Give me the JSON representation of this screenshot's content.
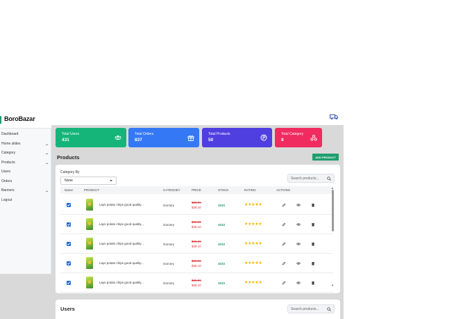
{
  "brand": {
    "name": "BoroBazar"
  },
  "sidebar": {
    "items": [
      {
        "label": "Dashboard",
        "chevron": false
      },
      {
        "label": "Home slides",
        "chevron": true
      },
      {
        "label": "Category",
        "chevron": true
      },
      {
        "label": "Products",
        "chevron": true
      },
      {
        "label": "Users",
        "chevron": false
      },
      {
        "label": "Orders",
        "chevron": false
      },
      {
        "label": "Banners",
        "chevron": true
      },
      {
        "label": "Logout",
        "chevron": false
      }
    ]
  },
  "stats": [
    {
      "title": "Total Users",
      "value": "431",
      "color": "#15b57a",
      "icon": "users-icon"
    },
    {
      "title": "Total Orders",
      "value": "837",
      "color": "#3478f6",
      "icon": "gift-icon"
    },
    {
      "title": "Total Products",
      "value": "50",
      "color": "#4f3fe0",
      "icon": "product-icon"
    },
    {
      "title": "Total Category",
      "value": "8",
      "color": "#ef2b5f",
      "icon": "category-icon"
    }
  ],
  "products": {
    "title": "Products",
    "add_button": "ADD PRODUCT",
    "filter_label": "Category By",
    "filter_value": "None",
    "search_placeholder": "Search products...",
    "columns": [
      "Name",
      "PRODUCT",
      "CATEGOEY",
      "PRICE",
      "STOCK",
      "RATING",
      "ACTIONS"
    ],
    "rows": [
      {
        "name": "Lays potato chips good quality...",
        "category": "Gorcery",
        "old_price": "$25.99",
        "price": "$38.10",
        "stock": "4033",
        "rating": "★★★★★"
      },
      {
        "name": "Lays potato chips good quality...",
        "category": "Gorcery",
        "old_price": "$25.99",
        "price": "$38.10",
        "stock": "4033",
        "rating": "★★★★★"
      },
      {
        "name": "Lays potato chips good quality...",
        "category": "Gorcery",
        "old_price": "$25.99",
        "price": "$38.10",
        "stock": "4033",
        "rating": "★★★★★"
      },
      {
        "name": "Lays potato chips good quality...",
        "category": "Gorcery",
        "old_price": "$25.99",
        "price": "$38.10",
        "stock": "4033",
        "rating": "★★★★★"
      },
      {
        "name": "Lays potato chips good quality...",
        "category": "Gorcery",
        "old_price": "$25.99",
        "price": "$38.10",
        "stock": "4033",
        "rating": "★★★★★"
      }
    ]
  },
  "users": {
    "title": "Users",
    "search_placeholder": "Search products..."
  }
}
